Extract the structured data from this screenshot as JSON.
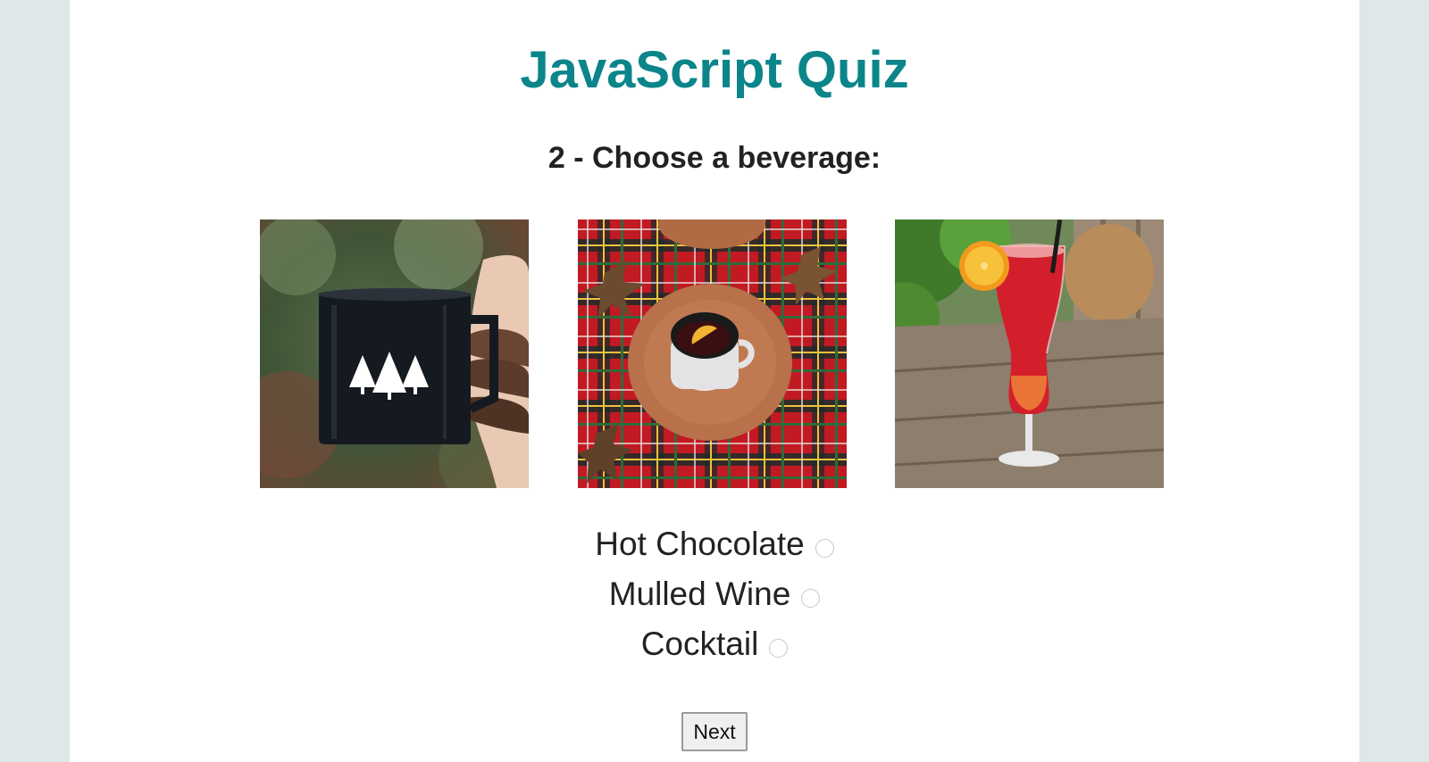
{
  "quiz": {
    "title": "JavaScript Quiz",
    "question": "2 - Choose a beverage:",
    "images": [
      {
        "icon": "hot-chocolate-mug-photo"
      },
      {
        "icon": "mulled-wine-cup-photo"
      },
      {
        "icon": "cocktail-glass-photo"
      }
    ],
    "options": [
      {
        "label": "Hot Chocolate",
        "selected": false
      },
      {
        "label": "Mulled Wine",
        "selected": false
      },
      {
        "label": "Cocktail",
        "selected": false
      }
    ],
    "next_label": "Next"
  },
  "colors": {
    "title": "#0b858a",
    "background": "#dfe7e8",
    "panel": "#ffffff"
  }
}
